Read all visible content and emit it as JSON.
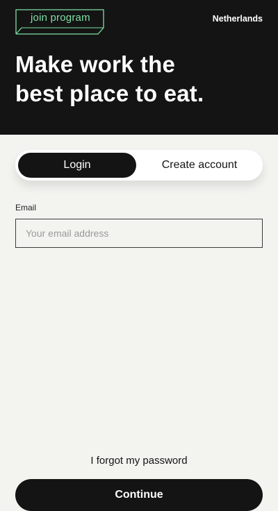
{
  "header": {
    "logo_text": "join program",
    "country": "Netherlands",
    "headline_line1": "Make work the",
    "headline_line2": "best place to eat.",
    "logo_color": "#7ee0a6",
    "background": "#141414"
  },
  "auth_toggle": {
    "login_label": "Login",
    "create_label": "Create account",
    "active": "Login"
  },
  "form": {
    "email_label": "Email",
    "email_placeholder": "Your email address",
    "email_value": ""
  },
  "footer": {
    "forgot_label": "I forgot my password",
    "continue_label": "Continue"
  }
}
